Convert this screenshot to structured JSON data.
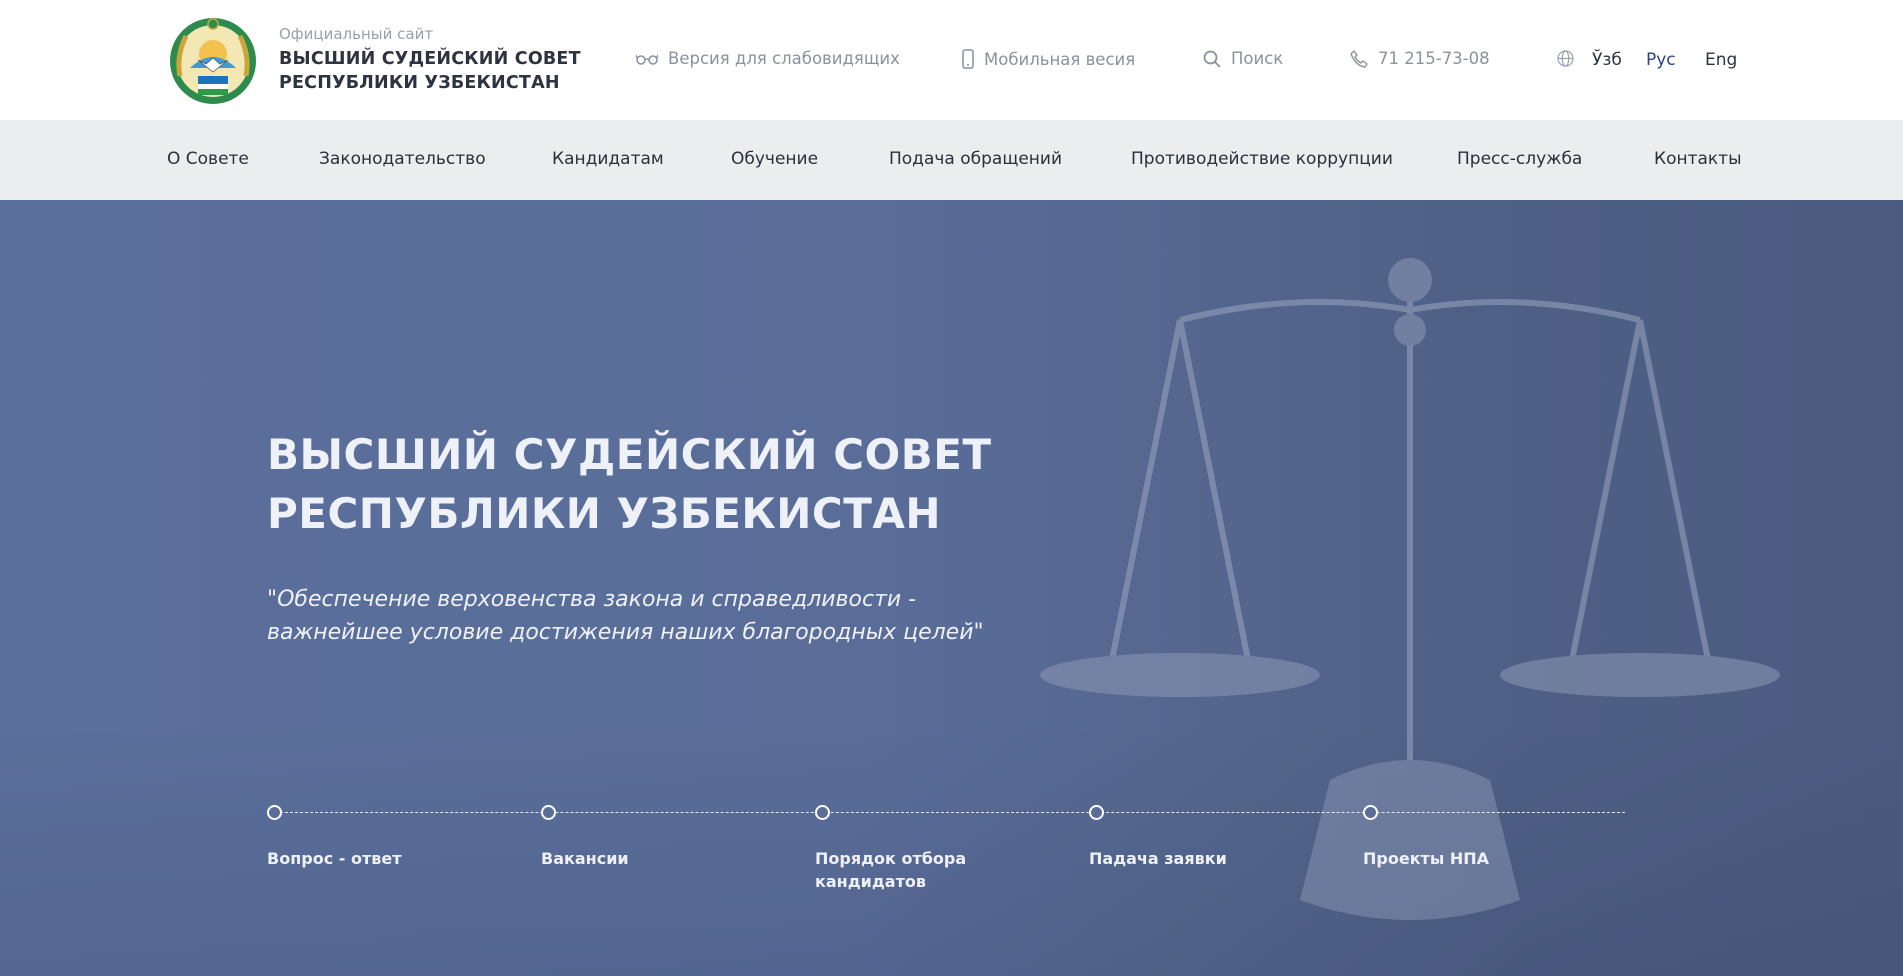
{
  "header": {
    "subtitle": "Официальный сайт",
    "title_line1": "ВЫСШИЙ СУДЕЙСКИЙ СОВЕТ",
    "title_line2": "РЕСПУБЛИКИ УЗБЕКИСТАН",
    "emblem_icon": "state-emblem-icon",
    "tools": {
      "vision": "Версия для слабовидящих",
      "mobile": "Мобильная весия",
      "search": "Поиск",
      "phone": "71 215-73-08"
    },
    "languages": {
      "uz": "Ўзб",
      "ru": "Рус",
      "en": "Eng",
      "active": "ru"
    }
  },
  "nav": {
    "items": [
      "О Совете",
      "Законодательство",
      "Кандидатам",
      "Обучение",
      "Подача обращений",
      "Противодействие коррупции",
      "Пресс-служба",
      "Контакты"
    ]
  },
  "hero": {
    "title_line1": "ВЫСШИЙ СУДЕЙСКИЙ СОВЕТ",
    "title_line2": "РЕСПУБЛИКИ УЗБЕКИСТАН",
    "quote_line1": "\"Обеспечение верховенства закона и справедливости -",
    "quote_line2": "важнейшее условие достижения наших благородных целей\"",
    "background_icon": "scales-of-justice-icon",
    "steps": [
      {
        "line1": "Вопрос - ответ",
        "line2": ""
      },
      {
        "line1": "Вакансии",
        "line2": ""
      },
      {
        "line1": "Порядок отбора",
        "line2": "кандидатов"
      },
      {
        "line1": "Падача заявки",
        "line2": ""
      },
      {
        "line1": "Проекты НПА",
        "line2": ""
      }
    ]
  },
  "colors": {
    "hero_bg": "#5a6d99",
    "nav_bg": "#ecedef",
    "active_lang": "#2c3e8f",
    "muted_text": "#8c919c"
  }
}
